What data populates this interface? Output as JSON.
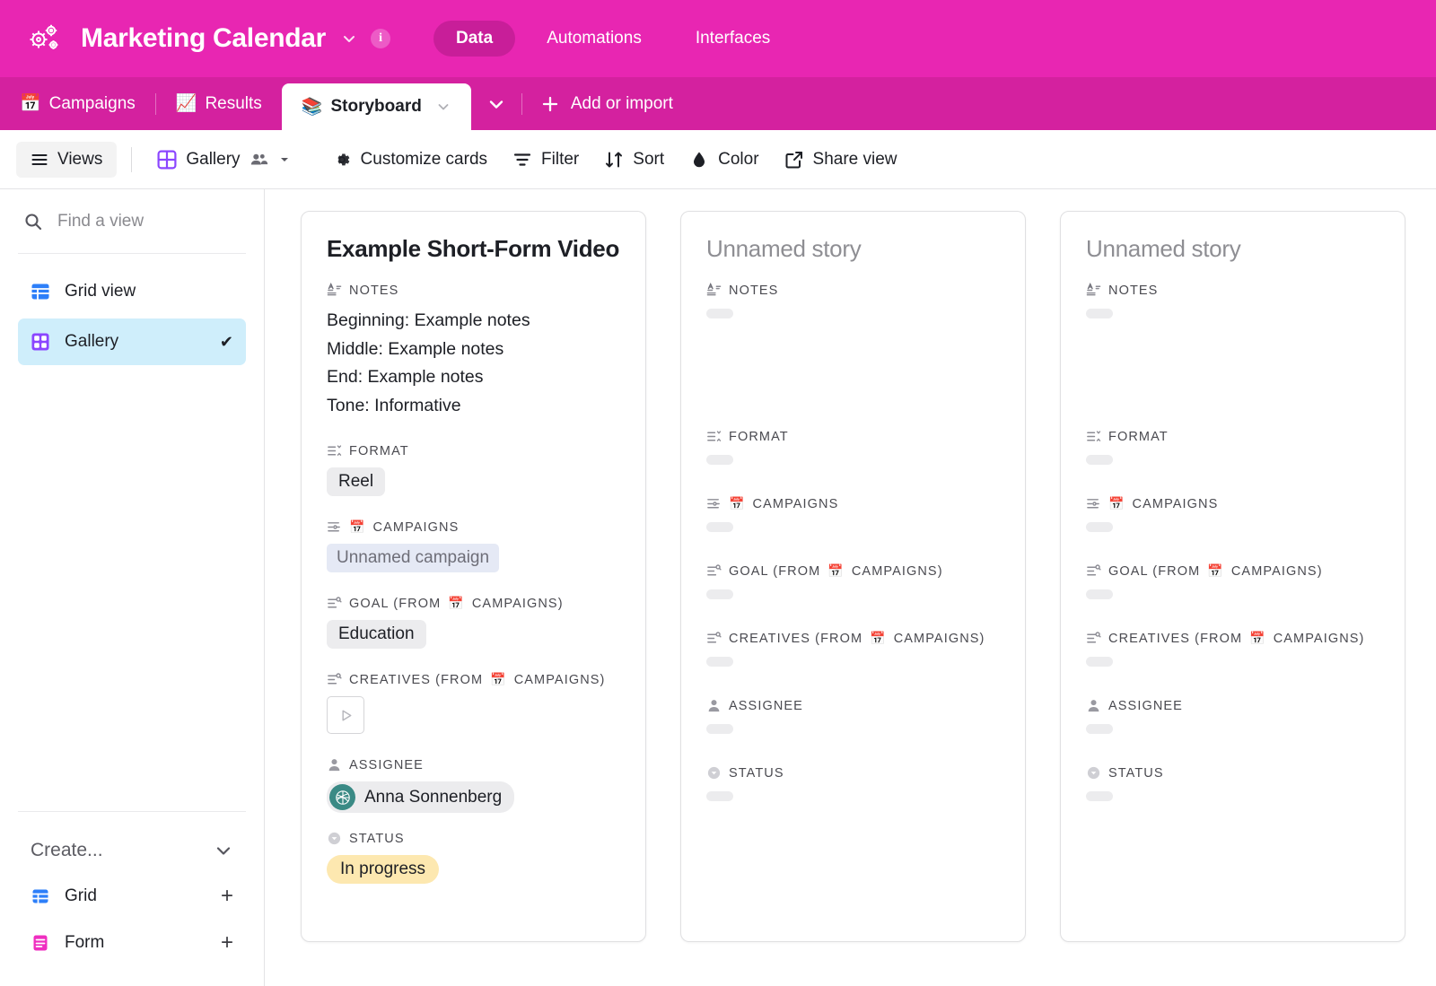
{
  "header": {
    "app_icon": "gears-icon",
    "title": "Marketing Calendar",
    "title_caret": "chevron-down-icon",
    "info_icon": "i",
    "nav": [
      {
        "label": "Data",
        "active": true
      },
      {
        "label": "Automations",
        "active": false
      },
      {
        "label": "Interfaces",
        "active": false
      }
    ],
    "colors": {
      "header_bg": "#E826B2",
      "tabbar_bg": "#D4219F",
      "active_pill_bg": "#C81E99"
    }
  },
  "tabs": {
    "items": [
      {
        "emoji": "📅",
        "label": "Campaigns",
        "active": false
      },
      {
        "emoji": "📈",
        "label": "Results",
        "active": false
      },
      {
        "emoji": "📚",
        "label": "Storyboard",
        "active": true
      }
    ],
    "overflow_icon": "chevron-down-icon",
    "add_label": "Add or import",
    "add_icon": "plus-icon"
  },
  "toolbar": {
    "views_label": "Views",
    "view_name": "Gallery",
    "customize_label": "Customize cards",
    "filter_label": "Filter",
    "sort_label": "Sort",
    "color_label": "Color",
    "share_label": "Share view"
  },
  "sidebar": {
    "search_placeholder": "Find a view",
    "views": [
      {
        "label": "Grid view",
        "icon": "grid-icon",
        "color": "#2d7ff9",
        "selected": false,
        "check": ""
      },
      {
        "label": "Gallery",
        "icon": "gallery-icon",
        "color": "#8b46ff",
        "selected": true,
        "check": "✔"
      }
    ],
    "create_label": "Create...",
    "create_items": [
      {
        "label": "Grid",
        "icon": "grid-icon",
        "color": "#2d7ff9",
        "plus": "+"
      },
      {
        "label": "Form",
        "icon": "form-icon",
        "color": "#ef2ec0",
        "plus": "+"
      }
    ]
  },
  "field_labels": {
    "notes": "NOTES",
    "format": "FORMAT",
    "campaigns": "CAMPAIGNS",
    "goal": "GOAL (FROM",
    "goal_suffix": "CAMPAIGNS)",
    "creatives": "CREATIVES (FROM",
    "creatives_suffix": "CAMPAIGNS)",
    "assignee": "ASSIGNEE",
    "status": "STATUS",
    "campaign_emoji": "📅"
  },
  "cards": [
    {
      "title": "Example Short-Form Video",
      "empty": false,
      "notes": [
        "Beginning: Example notes",
        "Middle: Example notes",
        "End: Example notes",
        "Tone: Informative"
      ],
      "format": "Reel",
      "campaigns": "Unnamed campaign",
      "goal": "Education",
      "creatives": "play-icon",
      "assignee": "Anna Sonnenberg",
      "status": "In progress"
    },
    {
      "title": "Unnamed story",
      "empty": true,
      "notes": [],
      "format": "",
      "campaigns": "",
      "goal": "",
      "creatives": "",
      "assignee": "",
      "status": ""
    },
    {
      "title": "Unnamed story",
      "empty": true,
      "notes": [],
      "format": "",
      "campaigns": "",
      "goal": "",
      "creatives": "",
      "assignee": "",
      "status": ""
    }
  ]
}
